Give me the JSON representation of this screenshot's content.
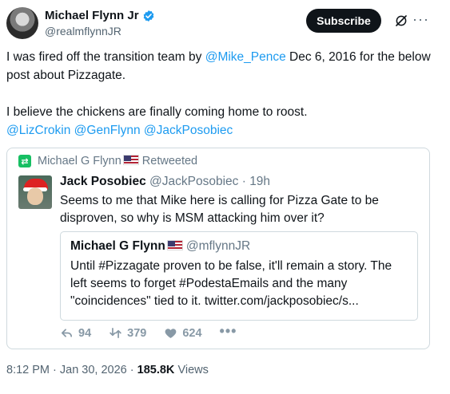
{
  "author": {
    "display_name": "Michael Flynn Jr",
    "handle": "@realmflynnJR"
  },
  "header": {
    "subscribe_label": "Subscribe",
    "more_label": "···"
  },
  "tweet": {
    "line1_prefix": "I was fired off the transition team by ",
    "line1_mention": "@Mike_Pence",
    "line1_suffix": " Dec 6, 2016 for the below post about Pizzagate.",
    "line2": "I believe the chickens are finally coming home to roost.",
    "mentions": [
      "@LizCrokin",
      "@GenFlynn",
      "@JackPosobiec"
    ]
  },
  "embed": {
    "retweeted_by": "Michael G Flynn",
    "retweeted_label": "Retweeted",
    "author_name": "Jack Posobiec",
    "author_handle": "@JackPosobiec",
    "time_ago": "19h",
    "text": "Seems to me that Mike here is calling for Pizza Gate to be disproven, so why is MSM attacking him over it?",
    "quote": {
      "author_name": "Michael G Flynn",
      "author_handle": "@mflynnJR",
      "text": "Until #Pizzagate proven to be false, it'll remain a story. The left seems to forget #PodestaEmails and the many \"coincidences\" tied to it. twitter.com/jackposobiec/s..."
    },
    "actions": {
      "replies": "94",
      "retweets": "379",
      "likes": "624",
      "more": "•••"
    }
  },
  "footer": {
    "time": "8:12 PM",
    "date": "Jan 30, 2026",
    "views_count": "185.8K",
    "views_label": "Views"
  },
  "colors": {
    "link": "#1d9bf0",
    "verified": "#1d9bf0",
    "retweet_green": "#17bf63",
    "subscribe_bg": "#0f1419"
  }
}
